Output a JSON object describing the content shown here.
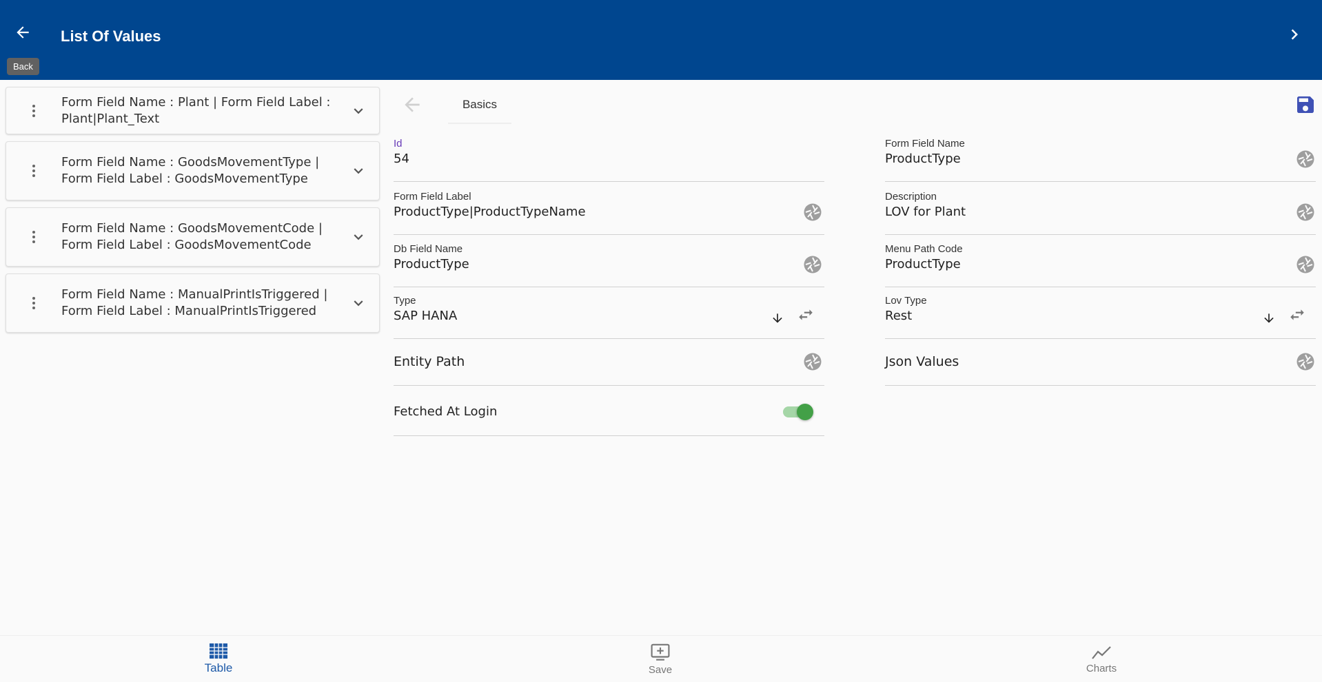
{
  "header": {
    "title": "List Of Values",
    "back_tooltip": "Back",
    "back_icon": "arrow-left-icon",
    "next_icon": "chevron-right-icon",
    "color": "#00468f"
  },
  "list": {
    "items": [
      {
        "text": "Form Field Name : Plant | Form Field Label : Plant|Plant_Text"
      },
      {
        "text": "Form Field Name : GoodsMovementType | Form Field Label : GoodsMovementType"
      },
      {
        "text": "Form Field Name : GoodsMovementCode | Form Field Label : GoodsMovementCode"
      },
      {
        "text": "Form Field Name : ManualPrintIsTriggered | Form Field Label : ManualPrintIsTriggered"
      }
    ]
  },
  "form": {
    "tab_label": "Basics",
    "id": {
      "label": "Id",
      "value": "54"
    },
    "form_field_name": {
      "label": "Form Field Name",
      "value": "ProductType"
    },
    "form_field_label": {
      "label": "Form Field Label",
      "value": "ProductType|ProductTypeName"
    },
    "description": {
      "label": "Description",
      "value": "LOV for Plant"
    },
    "db_field_name": {
      "label": "Db Field Name",
      "value": "ProductType"
    },
    "menu_path_code": {
      "label": "Menu Path Code",
      "value": "ProductType"
    },
    "type": {
      "label": "Type",
      "value": "SAP HANA"
    },
    "lov_type": {
      "label": "Lov Type",
      "value": "Rest"
    },
    "entity_path": {
      "label": "Entity Path"
    },
    "json_values": {
      "label": "Json Values"
    },
    "fetched_at_login": {
      "label": "Fetched At Login",
      "checked": true,
      "color": "#43a047"
    }
  },
  "bottom_nav": {
    "table": "Table",
    "save": "Save",
    "charts": "Charts",
    "active_color": "#1e5aa8"
  }
}
